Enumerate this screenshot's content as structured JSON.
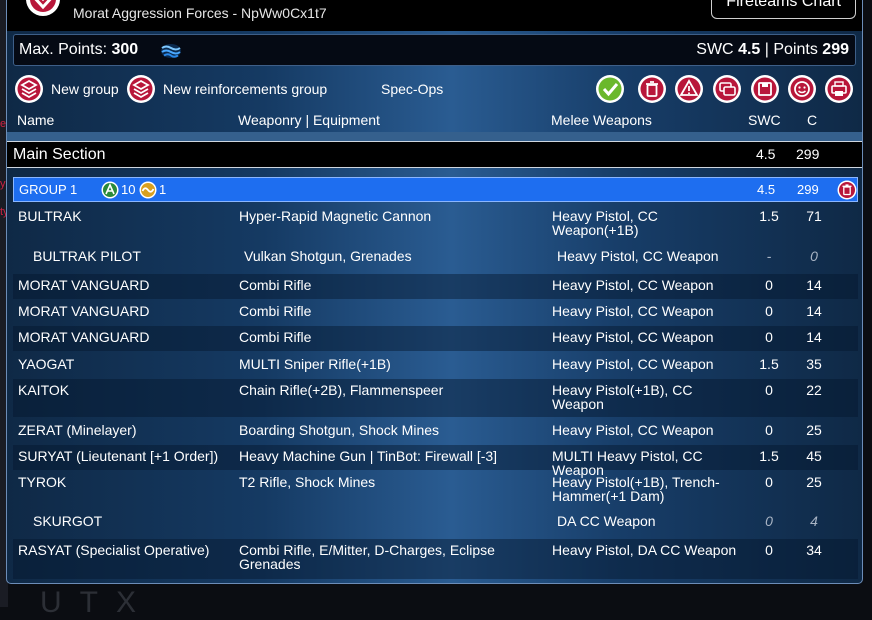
{
  "window": {
    "title": "Morat Aggression Forces - NpWw0Cx1t7",
    "fireteams_label": "Fireteams Chart"
  },
  "points": {
    "max_label": "Max. Points:",
    "max_value": "300",
    "swc_label": "SWC",
    "swc_value": "4.5",
    "sep": "|",
    "points_label": "Points",
    "points_value": "299"
  },
  "toolbar": {
    "new_group": "New group",
    "new_reinforcements": "New reinforcements group",
    "spec_ops": "Spec-Ops"
  },
  "columns": {
    "name": "Name",
    "weaponry": "Weaponry | Equipment",
    "melee": "Melee Weapons",
    "swc": "SWC",
    "c": "C"
  },
  "section": {
    "title": "Main Section",
    "swc": "4.5",
    "c": "299"
  },
  "group": {
    "label": "GROUP 1",
    "regular_orders": "10",
    "impetuous_orders": "1",
    "swc": "4.5",
    "c": "299"
  },
  "units": [
    {
      "name": "BULTRAK",
      "weapons": "Hyper-Rapid Magnetic Cannon",
      "melee": "Heavy Pistol, CC Weapon(+1B)",
      "swc": "1.5",
      "c": "71"
    },
    {
      "name": "BULTRAK PILOT",
      "weapons": "Vulkan Shotgun, Grenades",
      "melee": "Heavy Pistol, CC Weapon",
      "swc": "-",
      "c": "0"
    },
    {
      "name": "MORAT VANGUARD",
      "weapons": "Combi Rifle",
      "melee": "Heavy Pistol, CC Weapon",
      "swc": "0",
      "c": "14"
    },
    {
      "name": "MORAT VANGUARD",
      "weapons": "Combi Rifle",
      "melee": "Heavy Pistol, CC Weapon",
      "swc": "0",
      "c": "14"
    },
    {
      "name": "MORAT VANGUARD",
      "weapons": "Combi Rifle",
      "melee": "Heavy Pistol, CC Weapon",
      "swc": "0",
      "c": "14"
    },
    {
      "name": "YAOGAT",
      "weapons": "MULTI Sniper Rifle(+1B)",
      "melee": "Heavy Pistol, CC Weapon",
      "swc": "1.5",
      "c": "35"
    },
    {
      "name": "KAITOK",
      "weapons": "Chain Rifle(+2B), Flammenspeer",
      "melee": "Heavy Pistol(+1B), CC Weapon",
      "swc": "0",
      "c": "22"
    },
    {
      "name": "ZERAT (Minelayer)",
      "weapons": "Boarding Shotgun, Shock Mines",
      "melee": "Heavy Pistol, CC Weapon",
      "swc": "0",
      "c": "25"
    },
    {
      "name": "SURYAT (Lieutenant [+1 Order])",
      "weapons": "Heavy Machine Gun | TinBot: Firewall [-3]",
      "melee": "MULTI Heavy Pistol, CC Weapon",
      "swc": "1.5",
      "c": "45"
    },
    {
      "name": "TYROK",
      "weapons": "T2 Rifle, Shock Mines",
      "melee": "Heavy Pistol(+1B), Trench-Hammer(+1 Dam)",
      "swc": "0",
      "c": "25"
    },
    {
      "name": "SKURGOT",
      "weapons": "",
      "melee": "DA CC Weapon",
      "swc": "0",
      "c": "4"
    },
    {
      "name": "RASYAT (Specialist Operative)",
      "weapons": "Combi Rifle, E/Mitter, D-Charges, Eclipse Grenades",
      "melee": "Heavy Pistol, DA CC Weapon",
      "swc": "0",
      "c": "34"
    }
  ],
  "background": {
    "ghost_text": "UTX",
    "left_fragments": [
      "e",
      "y",
      "ty"
    ]
  },
  "icons": {
    "logo": "morat-logo-icon",
    "wave": "mode-toggle-icon",
    "group": "new-group-icon",
    "confirm": "check-icon",
    "delete": "trash-icon",
    "alert": "warning-icon",
    "chat": "chat-icon",
    "save": "save-icon",
    "smile": "face-icon",
    "print": "print-icon",
    "colors": {
      "accent": "#1e6ef0",
      "green": "#6ab82c",
      "red": "#b8163a"
    }
  }
}
